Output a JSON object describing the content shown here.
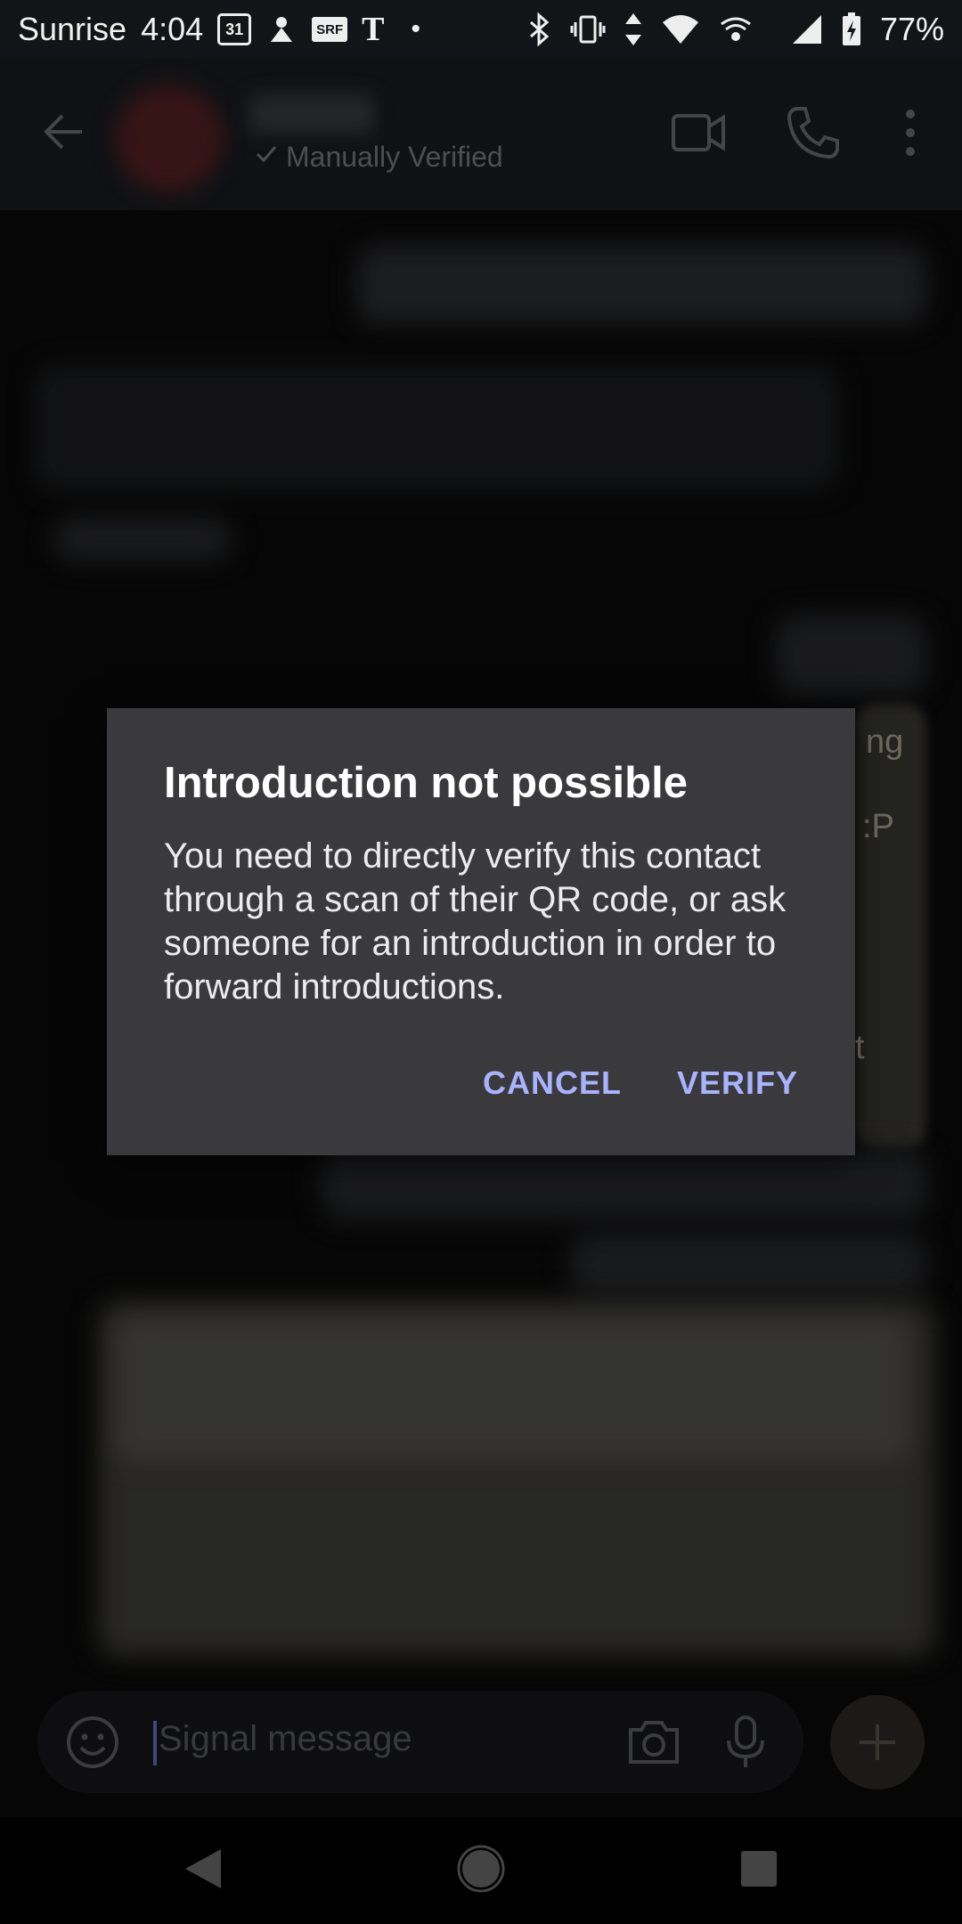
{
  "status_bar": {
    "carrier": "Sunrise",
    "time": "4:04",
    "calendar_day": "31",
    "srf_label": "SRF",
    "nyt_label": "T",
    "dot": "•",
    "battery": "77%",
    "icons": [
      "calendar-icon",
      "app-notification-icon",
      "srf-icon",
      "nyt-icon",
      "bluetooth-icon",
      "vibrate-icon",
      "data-arrows-icon",
      "wifi-icon",
      "hotspot-icon",
      "signal-icon",
      "battery-charging-icon"
    ]
  },
  "toolbar": {
    "subtitle": "Manually Verified",
    "icons": [
      "back-arrow-icon",
      "video-call-icon",
      "phone-call-icon",
      "more-vert-icon"
    ]
  },
  "background_peek": {
    "right_texts": [
      "ng",
      ":P",
      "t"
    ]
  },
  "compose": {
    "placeholder": "Signal message",
    "icons": [
      "emoji-icon",
      "camera-icon",
      "microphone-icon",
      "add-icon"
    ]
  },
  "dialog": {
    "title": "Introduction not possible",
    "message": "You need to directly verify this contact through a scan of their QR code, or ask someone for an introduction in order to forward introductions.",
    "cancel_label": "CANCEL",
    "verify_label": "VERIFY"
  },
  "navbar": {
    "icons": [
      "nav-back-icon",
      "nav-home-icon",
      "nav-recents-icon"
    ]
  },
  "colors": {
    "dialog_bg": "#3a3a3c",
    "accent": "#a8b3ff",
    "toolbar_bg": "#1a1c20",
    "statusbar_bg": "#121417"
  }
}
